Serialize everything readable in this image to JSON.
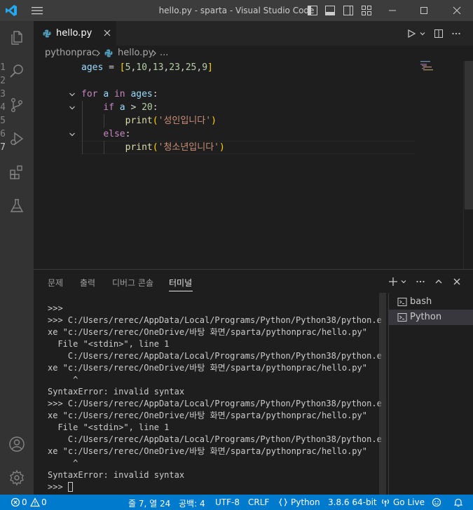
{
  "titlebar": {
    "title": "hello.py - sparta - Visual Studio Code"
  },
  "activitybar": {
    "items": [
      "explorer-icon",
      "search-icon",
      "source-control-icon",
      "run-debug-icon",
      "extensions-icon",
      "testing-icon"
    ],
    "bottom": [
      "account-icon",
      "settings-gear-icon"
    ]
  },
  "tabs": [
    {
      "label": "hello.py",
      "icon": "python-file-icon"
    }
  ],
  "breadcrumb": {
    "folder": "pythonprac",
    "file": "hello.py",
    "symbol": "..."
  },
  "editor": {
    "language": "python",
    "active_line": 7,
    "lines": [
      {
        "number": "1",
        "text": "ages = [5,10,13,23,25,9]"
      },
      {
        "number": "2",
        "text": ""
      },
      {
        "number": "3",
        "text": "for a in ages:"
      },
      {
        "number": "4",
        "text": "    if a > 20:"
      },
      {
        "number": "5",
        "text": "        print('성인입니다')"
      },
      {
        "number": "6",
        "text": "    else:"
      },
      {
        "number": "7",
        "text": "        print('청소년입니다')"
      }
    ]
  },
  "panel": {
    "tabs": [
      "문제",
      "출력",
      "디버그 콘솔",
      "터미널"
    ],
    "active_tab": "터미널",
    "terminal_lines": [
      ">>>",
      ">>> C:/Users/rerec/AppData/Local/Programs/Python/Python38/python.e",
      "xe \"c:/Users/rerec/OneDrive/바탕 화면/sparta/pythonprac/hello.py\"",
      "  File \"<stdin>\", line 1",
      "    C:/Users/rerec/AppData/Local/Programs/Python/Python38/python.e",
      "xe \"c:/Users/rerec/OneDrive/바탕 화면/sparta/pythonprac/hello.py\"",
      "     ^",
      "SyntaxError: invalid syntax",
      ">>> C:/Users/rerec/AppData/Local/Programs/Python/Python38/python.e",
      "xe \"c:/Users/rerec/OneDrive/바탕 화면/sparta/pythonprac/hello.py\"",
      "  File \"<stdin>\", line 1",
      "    C:/Users/rerec/AppData/Local/Programs/Python/Python38/python.e",
      "xe \"c:/Users/rerec/OneDrive/바탕 화면/sparta/pythonprac/hello.py\"",
      "     ^",
      "SyntaxError: invalid syntax"
    ],
    "prompt": ">>> ",
    "terminals": [
      {
        "label": "bash",
        "selected": false
      },
      {
        "label": "Python",
        "selected": true
      }
    ]
  },
  "statusbar": {
    "errors": "0",
    "warnings": "0",
    "position": "줄 7, 열 24",
    "spaces": "공백: 4",
    "encoding": "UTF-8",
    "eol": "CRLF",
    "language": "Python",
    "interpreter": "3.8.6 64-bit",
    "live": "Go Live"
  },
  "colors": {
    "titlebar": "#3c3c3c",
    "activitybar": "#333333",
    "editor_bg": "#1e1e1e",
    "statusbar": "#007acc"
  }
}
